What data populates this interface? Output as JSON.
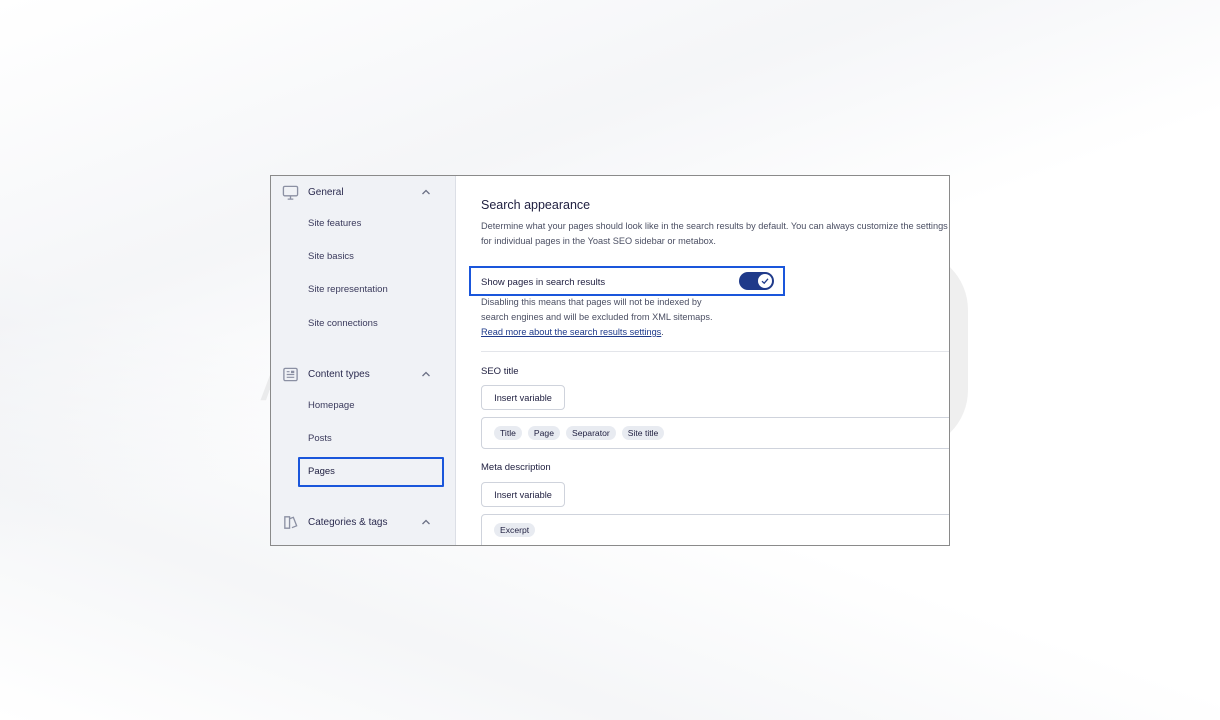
{
  "sidebar": {
    "groups": [
      {
        "label": "General",
        "icon": "monitor-icon",
        "items": [
          "Site features",
          "Site basics",
          "Site representation",
          "Site connections"
        ]
      },
      {
        "label": "Content types",
        "icon": "document-icon",
        "items": [
          "Homepage",
          "Posts",
          "Pages"
        ]
      },
      {
        "label": "Categories & tags",
        "icon": "tag-icon",
        "items": []
      }
    ],
    "selected_item": "Pages"
  },
  "main": {
    "title": "Search appearance",
    "description": "Determine what your pages should look like in the search results by default. You can always customize the settings for individual pages in the Yoast SEO sidebar or metabox.",
    "toggle": {
      "label": "Show pages in search results",
      "enabled": true,
      "help_text": "Disabling this means that pages will not be indexed by search engines and will be excluded from XML sitemaps.",
      "help_link": "Read more about the search results settings"
    },
    "seo_title": {
      "label": "SEO title",
      "insert_button": "Insert variable",
      "chips": [
        "Title",
        "Page",
        "Separator",
        "Site title"
      ]
    },
    "meta_description": {
      "label": "Meta description",
      "insert_button": "Insert variable",
      "chips": [
        "Excerpt"
      ]
    }
  },
  "watermark": {
    "text": "AZARSYS"
  },
  "colors": {
    "accent": "#1a56db",
    "toggle_on": "#1f3a8a",
    "sidebar_bg": "#f0f2f6"
  }
}
